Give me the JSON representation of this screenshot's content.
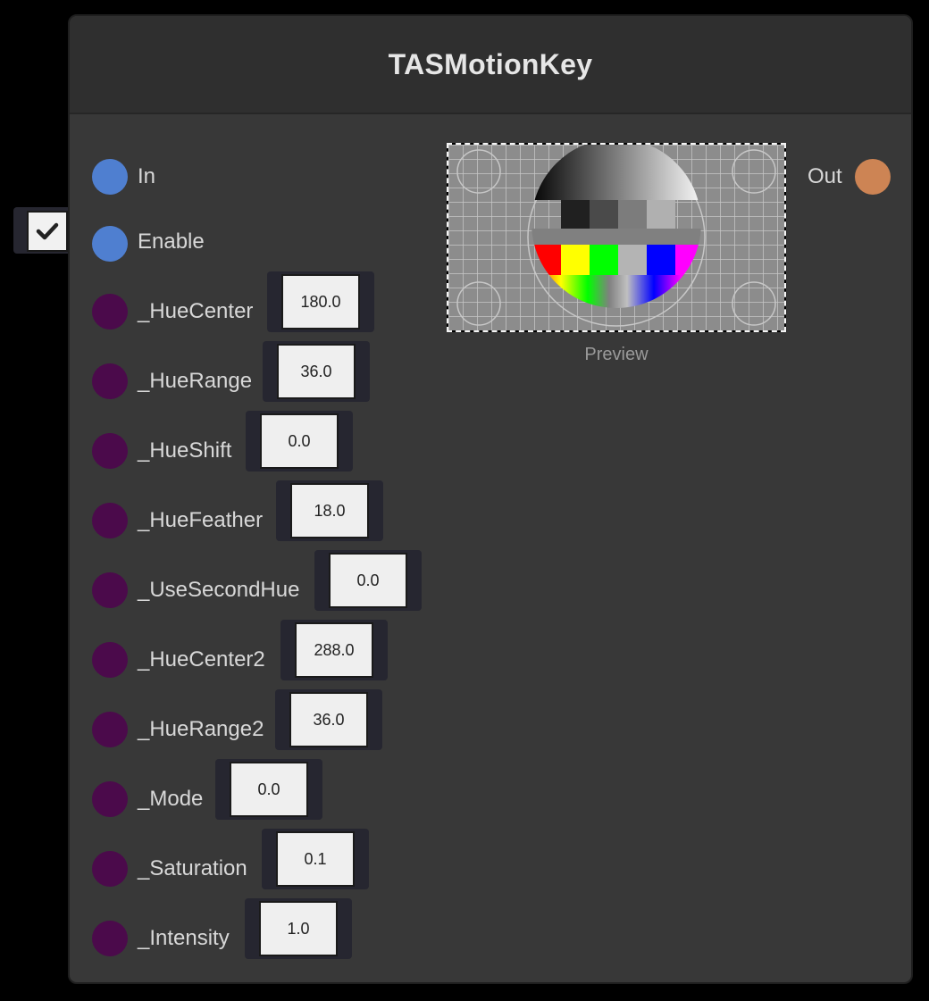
{
  "node": {
    "title": "TASMotionKey"
  },
  "inputs": {
    "in": {
      "label": "In"
    },
    "enable": {
      "label": "Enable",
      "checked": true
    }
  },
  "output": {
    "label": "Out"
  },
  "preview": {
    "label": "Preview"
  },
  "properties": [
    {
      "name": "_HueCenter",
      "value": "180.0"
    },
    {
      "name": "_HueRange",
      "value": "36.0"
    },
    {
      "name": "_HueShift",
      "value": "0.0"
    },
    {
      "name": "_HueFeather",
      "value": "18.0"
    },
    {
      "name": "_UseSecondHue",
      "value": "0.0"
    },
    {
      "name": "_HueCenter2",
      "value": "288.0"
    },
    {
      "name": "_HueRange2",
      "value": "36.0"
    },
    {
      "name": "_Mode",
      "value": "0.0"
    },
    {
      "name": "_Saturation",
      "value": "0.1"
    },
    {
      "name": "_Intensity",
      "value": "1.0"
    }
  ],
  "colors": {
    "exec_port": "#4f7fd0",
    "float_port": "#4b0a4b",
    "output_port": "#cd8454"
  }
}
